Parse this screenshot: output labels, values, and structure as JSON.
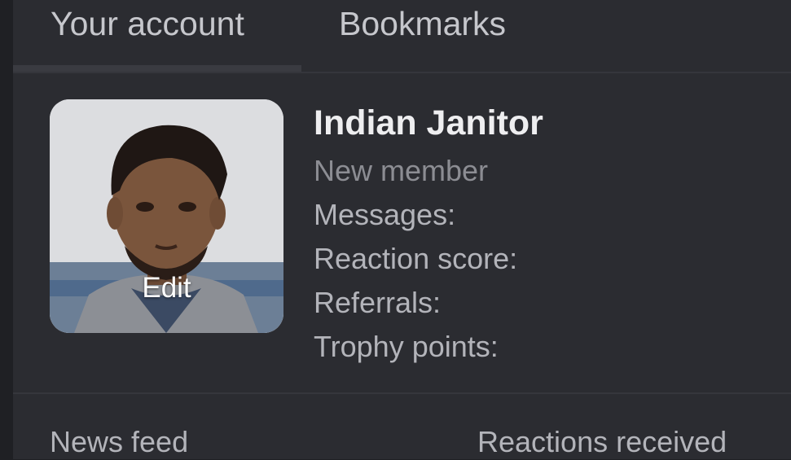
{
  "tabs": {
    "account": "Your account",
    "bookmarks": "Bookmarks"
  },
  "profile": {
    "name": "Indian Janitor",
    "title": "New member",
    "avatar_edit_label": "Edit",
    "stats": {
      "messages": "Messages:",
      "reaction_score": "Reaction score:",
      "referrals": "Referrals:",
      "trophy_points": "Trophy points:"
    }
  },
  "links": {
    "news_feed": "News feed",
    "reactions_received": "Reactions received"
  },
  "colors": {
    "background": "#2b2c31",
    "text_primary": "#eeeef0",
    "text_secondary": "#b3b4ba",
    "text_muted": "#8c8d93"
  }
}
